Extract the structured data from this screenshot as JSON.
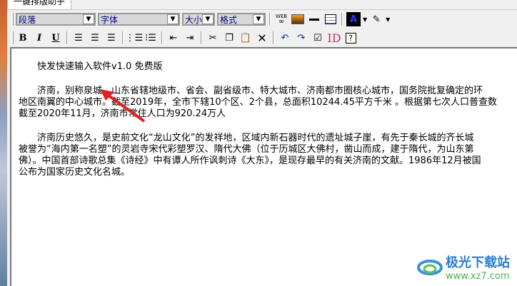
{
  "window": {
    "tab_title": "一键排版助手"
  },
  "toolbar": {
    "paragraph_select": "段落",
    "font_select": "字体",
    "size_select": "大小",
    "format_select": "格式",
    "web_label": "WEB"
  },
  "document": {
    "title": "快发快速输入软件v1.0 免费版",
    "para1": [
      "济南，别称泉城，山东省辖地级市、省会、副省级市、特大城市、济南都市圈核心城市，国务院批复确定的环",
      "地区南翼的中心城市。截至2019年，全市下辖10个区、2个县，总面积10244.45平方千米 。根据第七次人口普查数",
      "截至2020年11月，济南市常住人口为920.24万人"
    ],
    "para2": [
      "济南历史悠久，是史前文化“龙山文化”的发祥地，区域内新石器时代的遗址城子崖，有先于秦长城的齐长城",
      "被誉为“海内第一名塑”的灵岩寺宋代彩塑罗汉、隋代大佛（位于历城区大佛村，凿山而成，建于隋代，为山东第",
      "佛）。中国首部诗歌总集《诗经》中有谭人所作讽刺诗《大东》，是现存最早的有关济南的文献。1986年12月被国",
      "公布为国家历史文化名城。"
    ]
  },
  "watermark": {
    "name": "极光下载站",
    "url": "www.xz7.com"
  }
}
